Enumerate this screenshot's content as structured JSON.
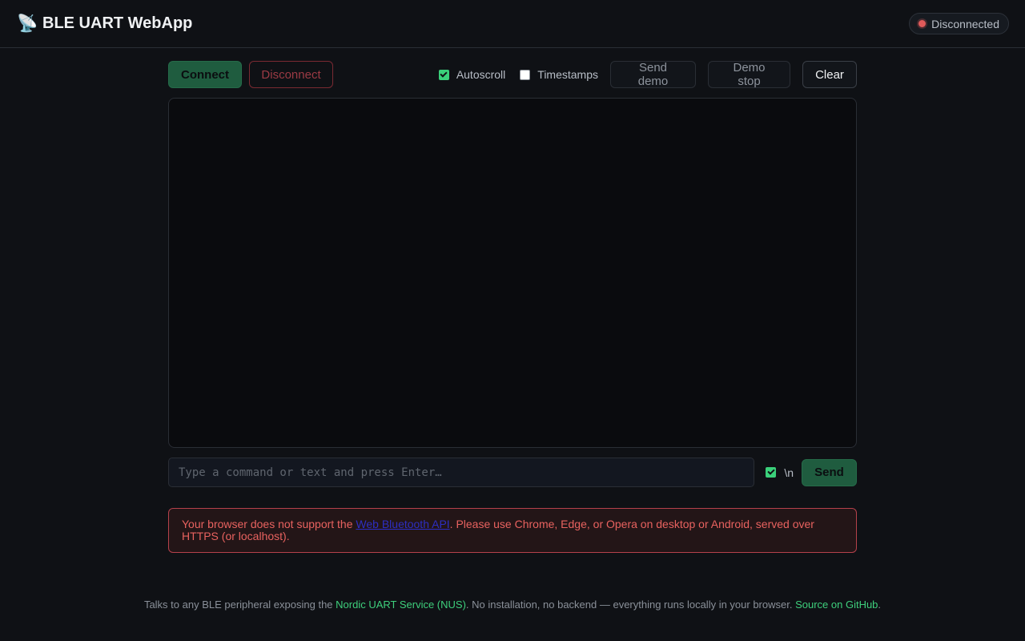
{
  "header": {
    "icon": "satellite-antenna-icon",
    "icon_glyph": "📡",
    "title": "BLE UART WebApp",
    "status": "Disconnected",
    "status_color": "#e05a5a"
  },
  "toolbar": {
    "connect_label": "Connect",
    "disconnect_label": "Disconnect",
    "autoscroll_label": "Autoscroll",
    "autoscroll_checked": true,
    "timestamps_label": "Timestamps",
    "timestamps_checked": false,
    "send_demo_label": "Send demo",
    "demo_stop_label": "Demo stop",
    "clear_label": "Clear"
  },
  "console": {
    "lines": []
  },
  "send": {
    "placeholder": "Type a command or text and press Enter…",
    "value": "",
    "newline_label": "\\n",
    "newline_checked": true,
    "send_label": "Send"
  },
  "alert": {
    "text_before": "Your browser does not support the ",
    "link_text": "Web Bluetooth API",
    "text_after": ". Please use Chrome, Edge, or Opera on desktop or Android, served over HTTPS (or localhost)."
  },
  "footer": {
    "text_before": "Talks to any BLE peripheral exposing the ",
    "nus_link": "Nordic UART Service (NUS)",
    "text_middle": ". No installation, no backend — everything runs locally in your browser. ",
    "github_link": "Source on GitHub",
    "text_after": "."
  },
  "colors": {
    "accent": "#3ecf7c",
    "danger": "#e8625f",
    "background": "#0f1115"
  }
}
